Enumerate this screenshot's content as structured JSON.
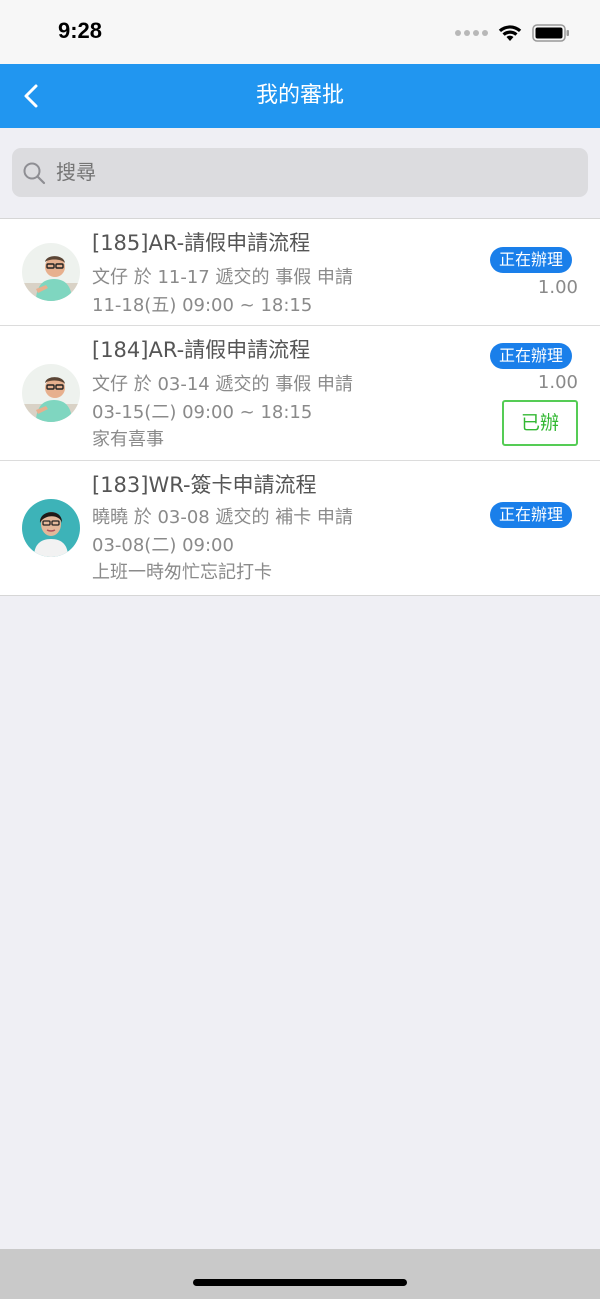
{
  "status": {
    "time": "9:28"
  },
  "nav": {
    "title": "我的審批"
  },
  "search": {
    "placeholder": "搜尋"
  },
  "items": [
    {
      "title": "[185]AR-請假申請流程",
      "line1": "文仔 於 11-17 遞交的 事假 申請",
      "line2": "11-18(五) 09:00 ~ 18:15",
      "badge": "正在辦理",
      "amount": "1.00",
      "avatar": "man-avatar"
    },
    {
      "title": "[184]AR-請假申請流程",
      "line1": "文仔 於 03-14 遞交的 事假 申請",
      "line2": "03-15(二) 09:00 ~ 18:15",
      "line3": "家有喜事",
      "badge": "正在辦理",
      "amount": "1.00",
      "done_label": "已辦",
      "avatar": "man-avatar"
    },
    {
      "title": "[183]WR-簽卡申請流程",
      "line1": "曉曉 於 03-08 遞交的 補卡 申請",
      "line2": "03-08(二) 09:00",
      "line3": "上班一時匆忙忘記打卡",
      "badge": "正在辦理",
      "avatar": "woman-avatar"
    }
  ],
  "colors": {
    "nav": "#2196f0",
    "badge": "#1a7fea",
    "done": "#33b833"
  }
}
